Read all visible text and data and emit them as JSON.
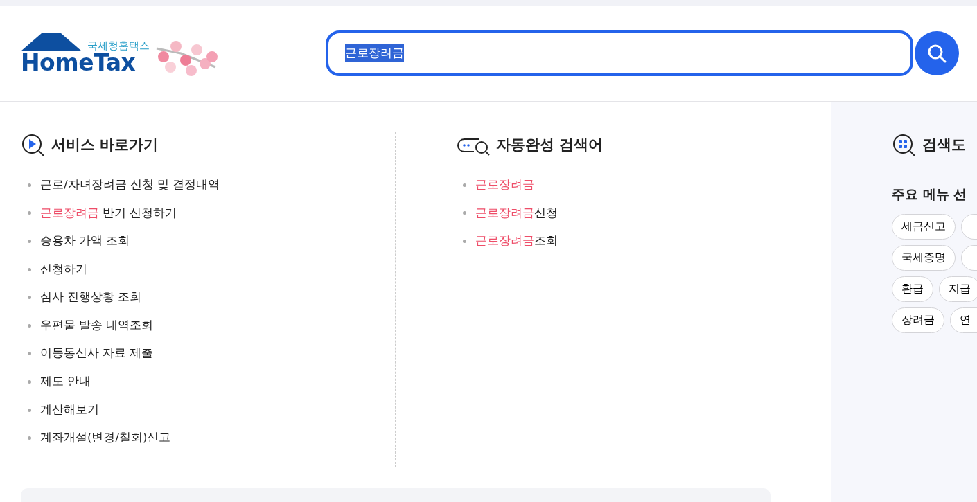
{
  "header": {
    "logo": {
      "subtitle": "국세청홈택스",
      "title": "HomeTax"
    },
    "search": {
      "value": "근로장려금",
      "value_selected": true
    }
  },
  "services": {
    "title": "서비스 바로가기",
    "items": [
      {
        "rest": "근로/자녀장려금 신청 및 결정내역"
      },
      {
        "match": "근로장려금",
        "rest": " 반기 신청하기"
      },
      {
        "rest": "승용차 가액 조회"
      },
      {
        "rest": "신청하기"
      },
      {
        "rest": "심사 진행상황 조회"
      },
      {
        "rest": "우편물 발송 내역조회"
      },
      {
        "rest": "이동통신사 자료 제출"
      },
      {
        "rest": "제도 안내"
      },
      {
        "rest": "계산해보기"
      },
      {
        "rest": "계좌개설(변경/철회)신고"
      }
    ]
  },
  "autocomplete": {
    "title": "자동완성 검색어",
    "items": [
      {
        "match": "근로장려금"
      },
      {
        "match": "근로장려금",
        "rest": "신청"
      },
      {
        "match": "근로장려금",
        "rest": "조회"
      }
    ]
  },
  "search_help": {
    "title": "검색도",
    "subtitle": "주요 메뉴 선",
    "chip_rows": [
      [
        {
          "label": "세금신고"
        },
        {}
      ],
      [
        {
          "label": "국세증명"
        },
        {}
      ],
      [
        {
          "label": "환급"
        },
        {
          "label": "지급"
        }
      ],
      [
        {
          "label": "장려금"
        },
        {
          "label": "연"
        }
      ]
    ]
  }
}
